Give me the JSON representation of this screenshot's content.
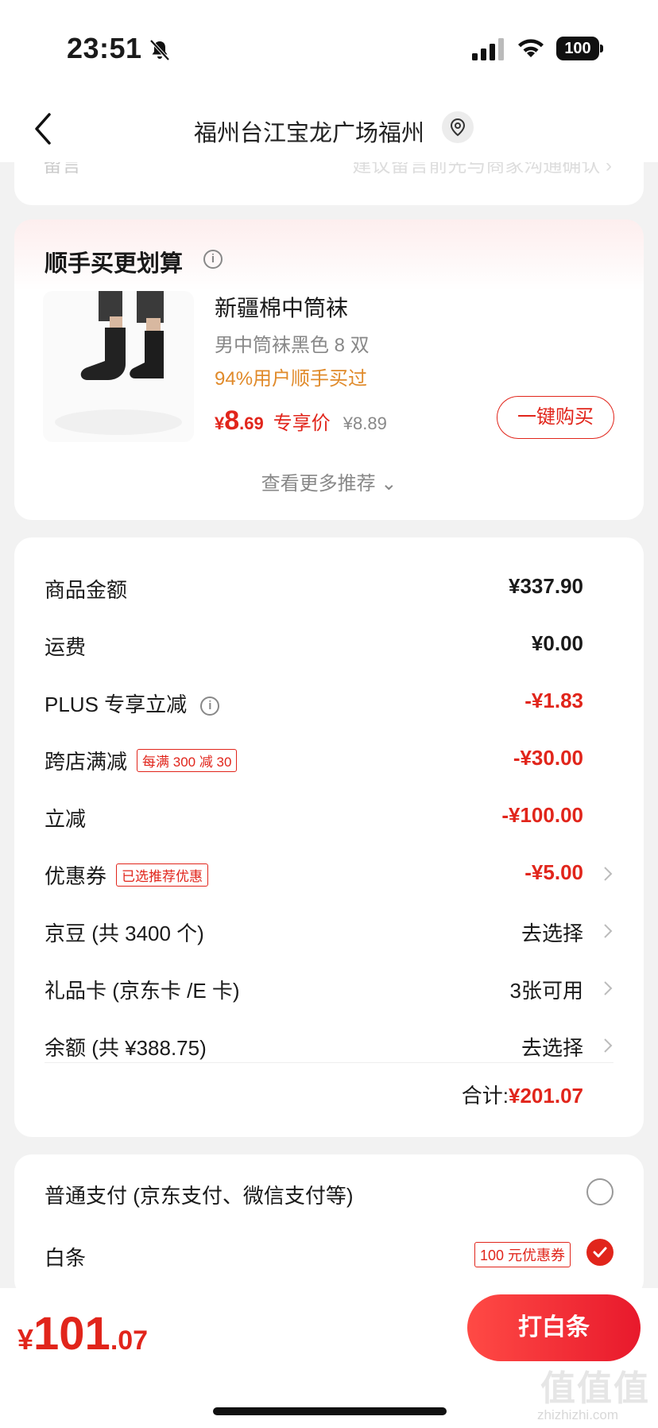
{
  "status_bar": {
    "time": "23:51",
    "battery": "100"
  },
  "nav": {
    "title": "福州台江宝龙广场福州"
  },
  "hidden_row": {
    "left": "留言",
    "right": "建议留言前先与商家沟通确认 ›"
  },
  "recommend": {
    "title": "顺手买更划算",
    "product_name": "新疆棉中筒袜",
    "product_spec": "男中筒袜黑色 8 双",
    "buyers_text": "94%用户顺手买过",
    "price_symbol": "¥",
    "price_int": "8",
    "price_dec": ".69",
    "price_label": "专享价",
    "original_price": "¥8.89",
    "buy_button": "一键购买",
    "more_label": "查看更多推荐 ⌄"
  },
  "summary": {
    "rows": [
      {
        "label": "商品金额",
        "value": "¥337.90"
      },
      {
        "label": "运费",
        "value": "¥0.00"
      },
      {
        "label": "PLUS 专享立减",
        "value": "-¥1.83"
      },
      {
        "label": "跨店满减",
        "tag": "每满 300 减 30",
        "value": "-¥30.00"
      },
      {
        "label": "立减",
        "value": "-¥100.00"
      },
      {
        "label": "优惠券",
        "tag": "已选推荐优惠",
        "value": "-¥5.00"
      },
      {
        "label": "京豆 (共 3400 个)",
        "value": "去选择"
      },
      {
        "label": "礼品卡 (京东卡 /E 卡)",
        "value": "3张可用"
      },
      {
        "label": "余额 (共 ¥388.75)",
        "value": "去选择"
      }
    ],
    "total_label": "合计:",
    "total_value": "¥201.07"
  },
  "payment": {
    "options": [
      {
        "label": "普通支付 (京东支付、微信支付等)",
        "selected": false
      },
      {
        "label": "白条",
        "coupon": "100 元优惠券",
        "selected": true
      }
    ]
  },
  "bottom": {
    "price_symbol": "¥",
    "price_int": "101",
    "price_dec": ".07",
    "pay_button": "打白条"
  },
  "watermark": {
    "text": "值值值",
    "sub": "zhizhizhi.com"
  },
  "colors": {
    "accent": "#e1251b",
    "orange": "#e08a2a"
  }
}
